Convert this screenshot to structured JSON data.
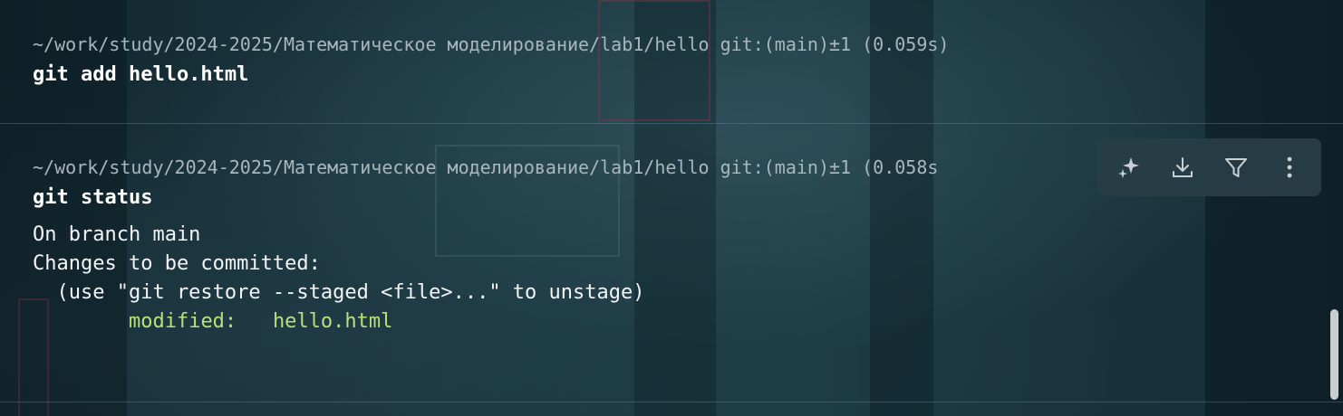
{
  "blocks": [
    {
      "prompt": "~/work/study/2024-2025/Математическое моделирование/lab1/hello git:(main)±1 (0.059s)",
      "command": "git add hello.html"
    },
    {
      "prompt": "~/work/study/2024-2025/Математическое моделирование/lab1/hello git:(main)±1 (0.058s",
      "command": "git status",
      "output": {
        "line1": "On branch main",
        "line2": "Changes to be committed:",
        "line3": "  (use \"git restore --staged <file>...\" to unstage)",
        "modified_label": "modified:",
        "modified_file": "hello.html"
      }
    }
  ],
  "toolbar": {
    "icons": [
      "ai-sparkle-icon",
      "download-icon",
      "filter-icon",
      "more-vertical-icon"
    ]
  },
  "colors": {
    "prompt": "#a9b6bc",
    "command": "#ffffff",
    "modified": "#b8e07a",
    "toolbar_bg": "#283e46"
  }
}
